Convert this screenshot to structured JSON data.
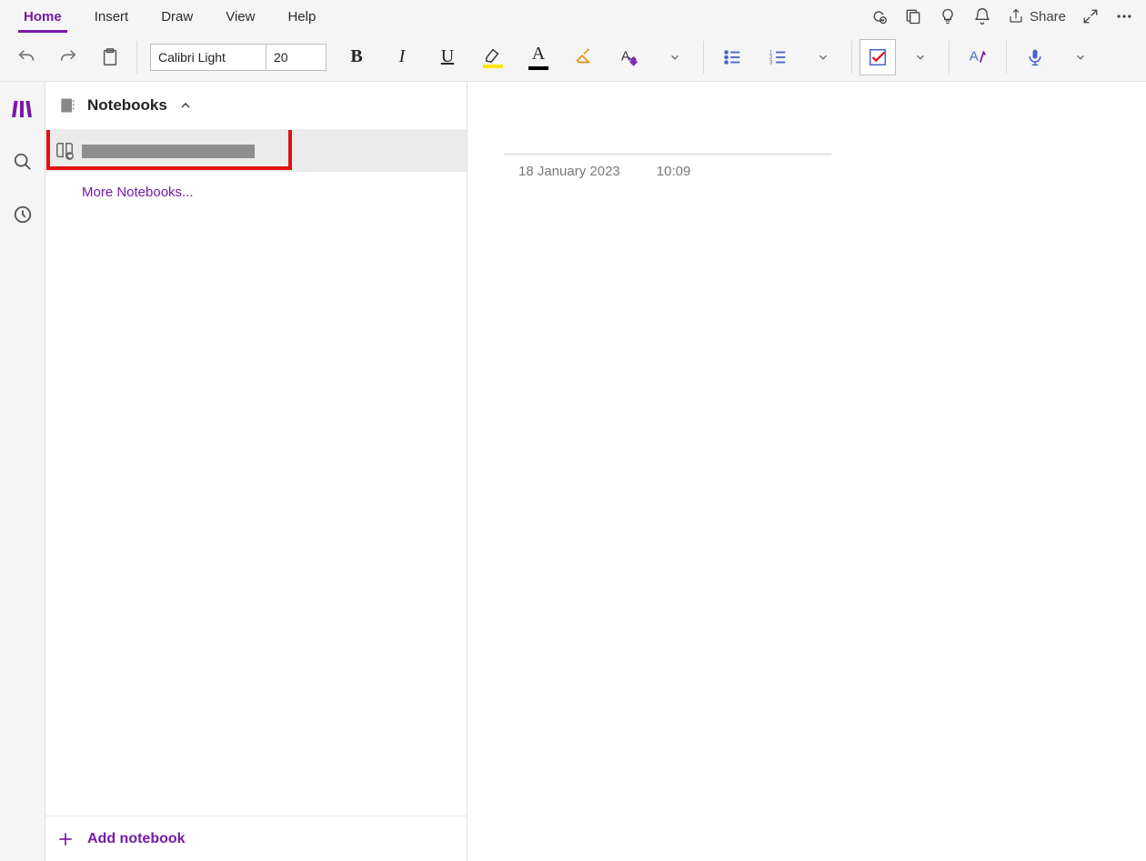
{
  "colors": {
    "accent": "#7719aa",
    "highlight_border": "#e01212",
    "highlight_yellow": "#ffe600"
  },
  "tabs": {
    "home": "Home",
    "insert": "Insert",
    "draw": "Draw",
    "view": "View",
    "help": "Help"
  },
  "titlebar": {
    "share_label": "Share"
  },
  "ribbon": {
    "font_name": "Calibri Light",
    "font_size": "20"
  },
  "sidebar": {
    "header_title": "Notebooks",
    "more_notebooks": "More Notebooks...",
    "add_notebook": "Add notebook"
  },
  "page": {
    "date": "18 January 2023",
    "time": "10:09"
  }
}
